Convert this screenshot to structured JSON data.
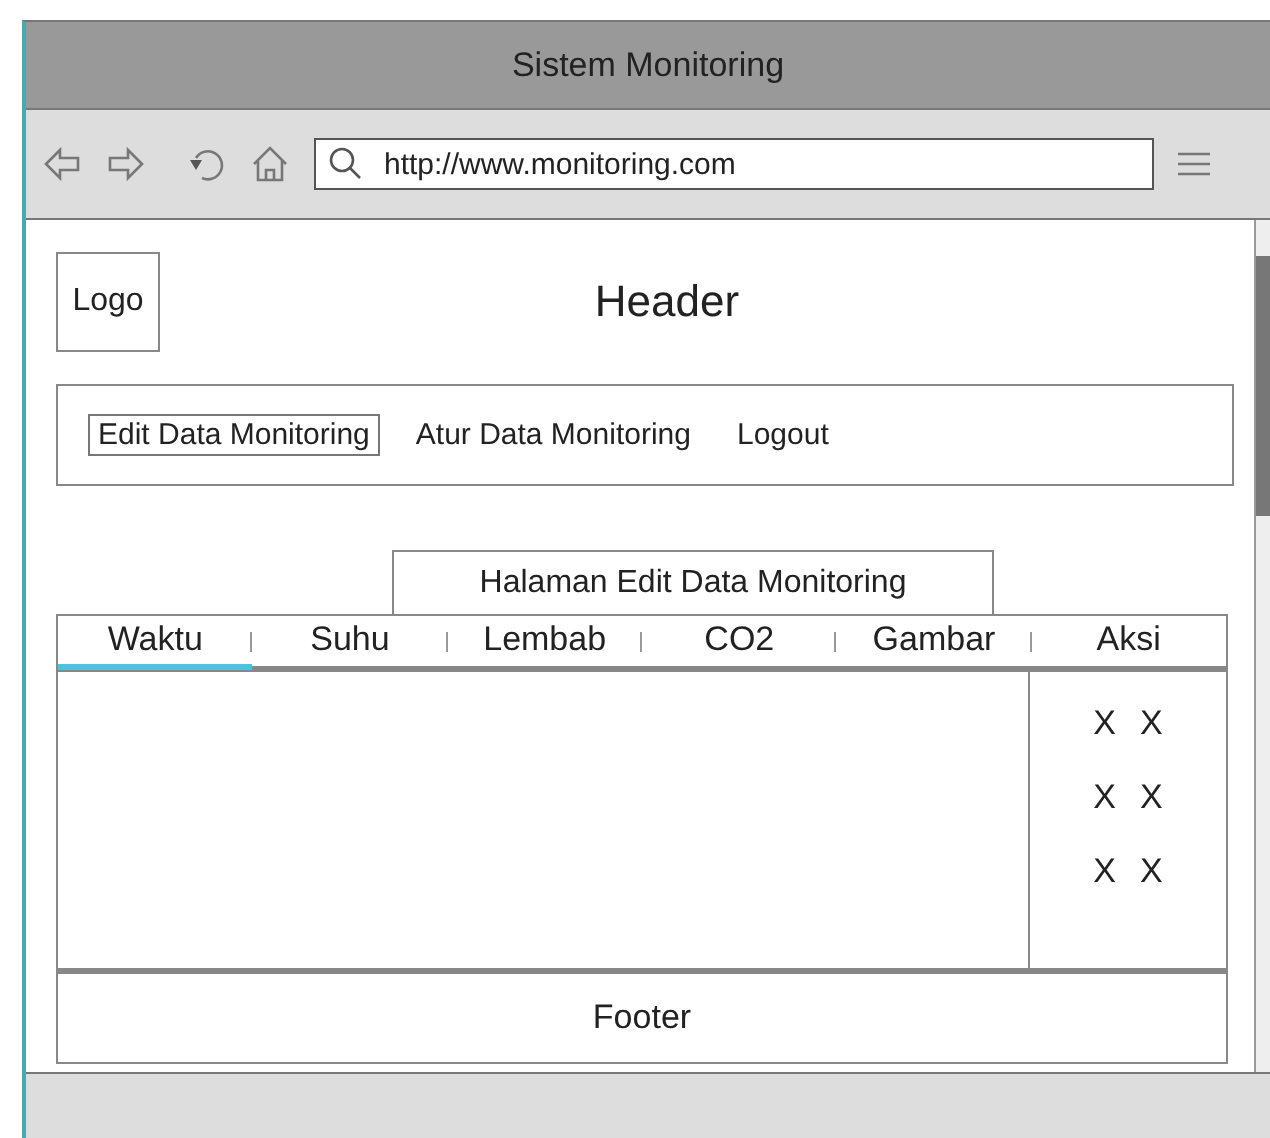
{
  "window": {
    "title": "Sistem Monitoring"
  },
  "toolbar": {
    "url": "http://www.monitoring.com"
  },
  "logo": "Logo",
  "header": "Header",
  "nav": [
    {
      "label": "Edit Data Monitoring",
      "selected": true
    },
    {
      "label": "Atur Data Monitoring",
      "selected": false
    },
    {
      "label": "Logout",
      "selected": false
    }
  ],
  "page_title": "Halaman Edit Data Monitoring",
  "tabs": [
    {
      "label": "Waktu",
      "selected": true
    },
    {
      "label": "Suhu",
      "selected": false
    },
    {
      "label": "Lembab",
      "selected": false
    },
    {
      "label": "CO2",
      "selected": false
    },
    {
      "label": "Gambar",
      "selected": false
    },
    {
      "label": "Aksi",
      "selected": false
    }
  ],
  "actions": [
    [
      "X",
      "X"
    ],
    [
      "X",
      "X"
    ],
    [
      "X",
      "X"
    ]
  ],
  "footer": "Footer"
}
